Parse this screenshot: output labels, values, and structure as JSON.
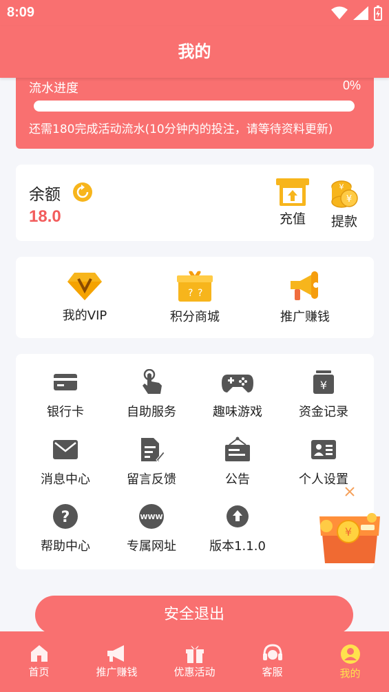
{
  "status_bar": {
    "time": "8:09"
  },
  "header": {
    "title": "我的"
  },
  "progress": {
    "label": "流水进度",
    "percent_text": "0%",
    "percent": 0,
    "note": "还需180完成活动流水(10分钟内的投注，请等待资料更新)"
  },
  "balance": {
    "title": "余额",
    "amount": "18.0",
    "recharge_label": "充值",
    "withdraw_label": "提款"
  },
  "features": [
    {
      "label": "我的VIP",
      "icon": "vip-diamond-icon"
    },
    {
      "label": "积分商城",
      "icon": "gift-box-icon"
    },
    {
      "label": "推广赚钱",
      "icon": "megaphone-icon"
    }
  ],
  "services": [
    {
      "label": "银行卡",
      "icon": "bank-card-icon"
    },
    {
      "label": "自助服务",
      "icon": "touch-hand-icon"
    },
    {
      "label": "趣味游戏",
      "icon": "gamepad-icon"
    },
    {
      "label": "资金记录",
      "icon": "fund-record-icon"
    },
    {
      "label": "消息中心",
      "icon": "envelope-icon"
    },
    {
      "label": "留言反馈",
      "icon": "feedback-icon"
    },
    {
      "label": "公告",
      "icon": "notice-board-icon"
    },
    {
      "label": "个人设置",
      "icon": "id-card-icon"
    },
    {
      "label": "帮助中心",
      "icon": "help-icon"
    },
    {
      "label": "专属网址",
      "icon": "www-icon"
    },
    {
      "label": "版本1.1.0",
      "icon": "upload-icon"
    }
  ],
  "logout_label": "安全退出",
  "tabs": [
    {
      "label": "首页",
      "icon": "home-icon"
    },
    {
      "label": "推广赚钱",
      "icon": "megaphone-icon"
    },
    {
      "label": "优惠活动",
      "icon": "gift-icon"
    },
    {
      "label": "客服",
      "icon": "headset-icon"
    },
    {
      "label": "我的",
      "icon": "user-icon",
      "active": true
    }
  ],
  "colors": {
    "primary": "#f97070",
    "active_tab": "#ffe14d",
    "amount": "#f25c5c",
    "gold": "#f7b51c",
    "icon_dark": "#555555"
  }
}
